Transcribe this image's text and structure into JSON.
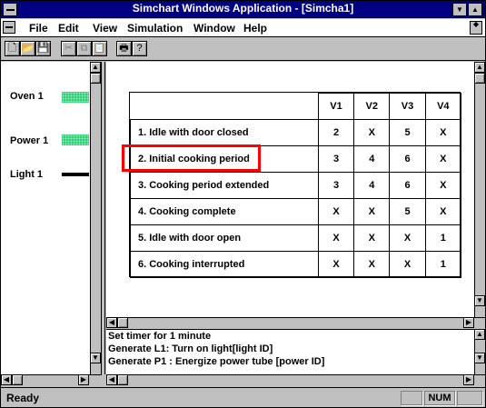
{
  "window": {
    "title": "Simchart Windows Application - [Simcha1]",
    "minimize_glyph": "▼",
    "maximize_glyph": "▲",
    "restore_glyph": "◆"
  },
  "menu": {
    "items": [
      "File",
      "Edit",
      "View",
      "Simulation",
      "Window",
      "Help"
    ]
  },
  "toolbar": {
    "buttons": [
      {
        "icon": "new-file-icon",
        "glyph": "🗋",
        "enabled": true
      },
      {
        "icon": "open-file-icon",
        "glyph": "📂",
        "enabled": true
      },
      {
        "icon": "save-icon",
        "glyph": "💾",
        "enabled": true
      },
      {
        "icon": "cut-icon",
        "glyph": "✂",
        "enabled": false
      },
      {
        "icon": "copy-icon",
        "glyph": "⧉",
        "enabled": false
      },
      {
        "icon": "paste-icon",
        "glyph": "📋",
        "enabled": false
      },
      {
        "icon": "print-icon",
        "glyph": "🖶",
        "enabled": true
      },
      {
        "icon": "help-icon",
        "glyph": "?",
        "enabled": true
      }
    ]
  },
  "signals": [
    {
      "label": "Oven 1",
      "kind": "green-pattern"
    },
    {
      "label": "Power 1",
      "kind": "green-pattern"
    },
    {
      "label": "Light 1",
      "kind": "black-line"
    }
  ],
  "state_table": {
    "columns": [
      "V1",
      "V2",
      "V3",
      "V4"
    ],
    "rows": [
      {
        "label": "1. Idle with door closed",
        "values": [
          "2",
          "X",
          "5",
          "X"
        ]
      },
      {
        "label": "2. Initial cooking period",
        "values": [
          "3",
          "4",
          "6",
          "X"
        ]
      },
      {
        "label": "3. Cooking period extended",
        "values": [
          "3",
          "4",
          "6",
          "X"
        ]
      },
      {
        "label": "4. Cooking complete",
        "values": [
          "X",
          "X",
          "5",
          "X"
        ]
      },
      {
        "label": "5. Idle with door open",
        "values": [
          "X",
          "X",
          "X",
          "1"
        ]
      },
      {
        "label": "6. Cooking interrupted",
        "values": [
          "X",
          "X",
          "X",
          "1"
        ]
      }
    ],
    "highlighted_row": 1,
    "highlight_color": "#ff0000"
  },
  "log": {
    "lines": [
      "Set timer for 1 minute",
      "Generate L1: Turn on light[light ID]",
      "Generate P1 : Energize power tube [power ID]"
    ]
  },
  "status": {
    "text": "Ready",
    "indicator": "NUM"
  },
  "colors": {
    "title_bar": "#000080",
    "chrome": "#c0c0c0",
    "signal_green": "#33cc77"
  }
}
